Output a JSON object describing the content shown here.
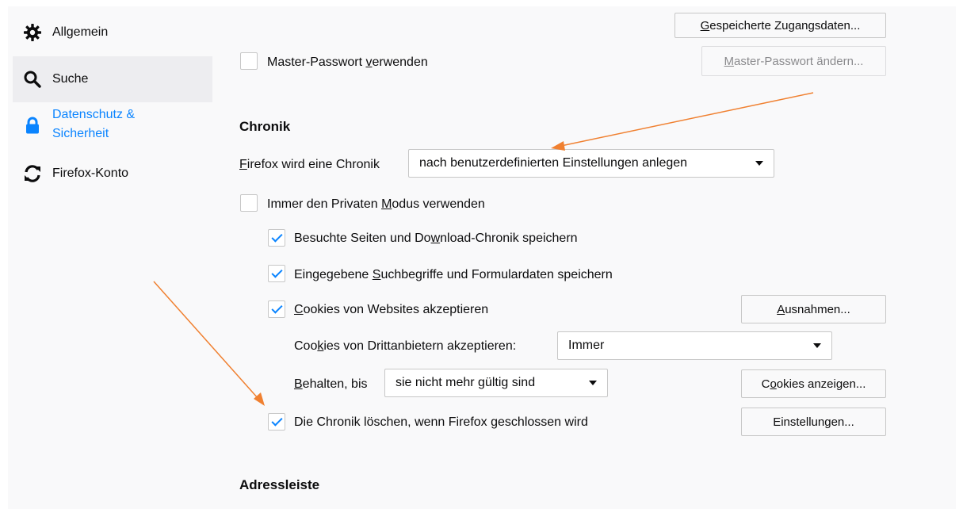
{
  "sidebar": {
    "items": [
      {
        "label": "Allgemein",
        "icon": "gear-icon"
      },
      {
        "label": "Suche",
        "icon": "search-icon"
      },
      {
        "label_line1": "Datenschutz &",
        "label_line2": "Sicherheit",
        "icon": "lock-icon"
      },
      {
        "label": "Firefox-Konto",
        "icon": "sync-icon"
      }
    ]
  },
  "logins": {
    "saved_logins_button": {
      "pre": "",
      "accel": "G",
      "post": "espeicherte Zugangsdaten..."
    },
    "master_password_checkbox": {
      "checked": false,
      "pre": "Master-Passwort ",
      "accel": "v",
      "post": "erwenden"
    },
    "change_master_button": {
      "pre": "",
      "accel": "M",
      "post": "aster-Passwort ändern..."
    }
  },
  "history": {
    "heading": "Chronik",
    "mode_label": {
      "pre": "",
      "accel": "F",
      "post": "irefox wird eine Chronik"
    },
    "mode_select": "nach benutzerdefinierten Einstellungen anlegen",
    "private_mode": {
      "checked": false,
      "pre": "Immer den Privaten ",
      "accel": "M",
      "post": "odus verwenden"
    },
    "remember_history": {
      "checked": true,
      "pre": "Besuchte Seiten und Do",
      "accel": "w",
      "post": "nload-Chronik speichern"
    },
    "remember_forms": {
      "checked": true,
      "pre": "Eingegebene ",
      "accel": "S",
      "post": "uchbegriffe und Formulardaten speichern"
    },
    "accept_cookies": {
      "checked": true,
      "pre": "",
      "accel": "C",
      "post": "ookies von Websites akzeptieren"
    },
    "exceptions_button": {
      "pre": "",
      "accel": "A",
      "post": "usnahmen..."
    },
    "third_party_label": {
      "pre": "Coo",
      "accel": "k",
      "post": "ies von Drittanbietern akzeptieren:"
    },
    "third_party_select": "Immer",
    "keep_until_label": {
      "pre": "",
      "accel": "B",
      "post": "ehalten, bis"
    },
    "keep_until_select": "sie nicht mehr gültig sind",
    "show_cookies_button": {
      "pre": "C",
      "accel": "o",
      "post": "okies anzeigen..."
    },
    "clear_on_close": {
      "checked": true,
      "pre": "Die Chronik löschen, wenn Firefox ",
      "accel": "g",
      "post": "eschlossen wird"
    },
    "settings_button": {
      "pre": "Einstellungen...",
      "accel": "",
      "post": ""
    }
  },
  "address_bar": {
    "heading": "Adressleiste"
  },
  "annotations": {
    "arrow_color": "#f08030"
  }
}
